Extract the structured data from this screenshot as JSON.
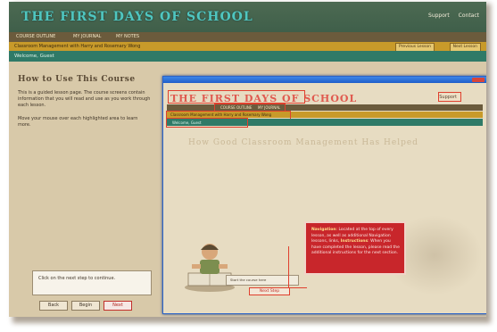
{
  "site": {
    "logo": "THE FIRST DAYS OF SCHOOL",
    "top_links": [
      "Support",
      "Contact"
    ]
  },
  "nav": {
    "items": [
      "COURSE OUTLINE",
      "MY JOURNAL",
      "MY NOTES"
    ]
  },
  "lesson_bar": {
    "title": "Classroom Management with Harry and Rosemary Wong",
    "buttons": [
      "Previous Lesson",
      "Next Lesson"
    ]
  },
  "welcome": {
    "text": "Welcome, Guest"
  },
  "left": {
    "heading": "How to Use This Course",
    "paragraphs": [
      "This is a guided lesson page. The course screens contain information that you will read and use as you work through each lesson.",
      "Move your mouse over each highlighted area to learn more."
    ],
    "note": "Click on the next step to continue.",
    "buttons": {
      "back": "Back",
      "begin": "Begin",
      "next": "Next"
    }
  },
  "window": {
    "logo": "THE FIRST DAYS OF SCHOOL",
    "support": "Support",
    "nav_items": [
      "COURSE OUTLINE",
      "MY JOURNAL"
    ],
    "lesson_title": "Classroom Management with Harry and Rosemary Wong",
    "welcome": "Welcome, Guest",
    "ghost_heading": "How Good Classroom Management Has Helped",
    "callout": {
      "title1": "Navigation",
      "text1": "Located at the top of every lesson, as well as additional Navigation lessons, links,",
      "title2": "Instructions",
      "text2": "When you have completed the lesson, please read the additional instructions for the next section."
    },
    "mini_box": "Start the course here",
    "next_button": "Next Step"
  },
  "colors": {
    "header": "#3f5f4a",
    "logo": "#4fc6c0",
    "lesson_bar": "#c89a2a",
    "welcome_bar": "#2f7a67",
    "callout": "#c8262b",
    "highlight": "#e0402e",
    "window_border": "#2b63c7"
  }
}
